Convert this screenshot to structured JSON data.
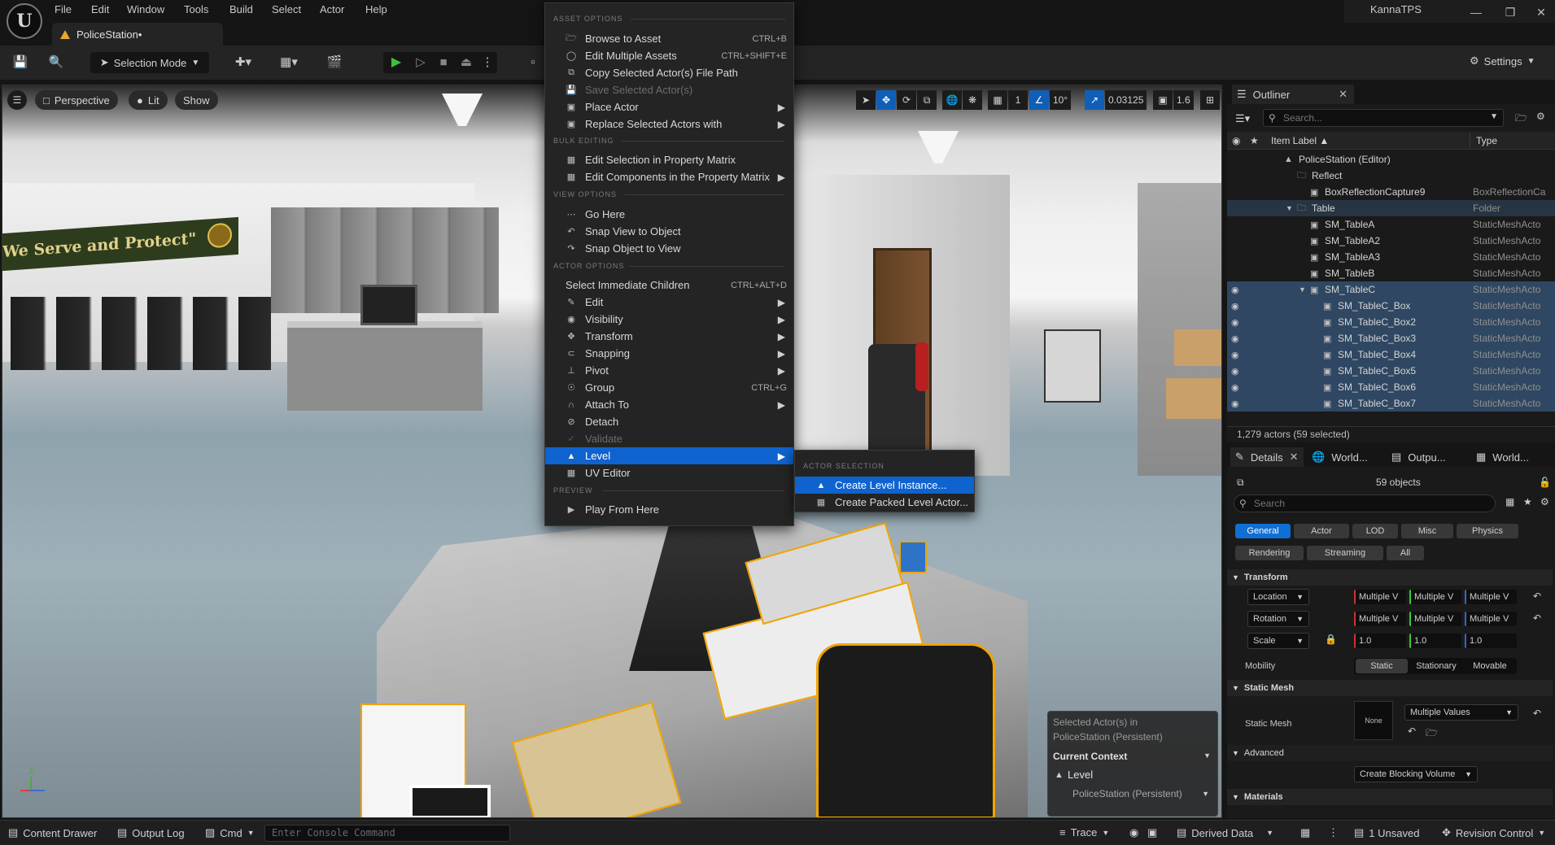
{
  "menubar": {
    "items": [
      "File",
      "Edit",
      "Window",
      "Tools",
      "Build",
      "Select",
      "Actor",
      "Help"
    ],
    "logo": "U",
    "doc_tab": "PoliceStation•",
    "window_title": "KannaTPS"
  },
  "toolbar": {
    "selection_mode": "Selection Mode",
    "settings": "Settings"
  },
  "viewport": {
    "perspective": "Perspective",
    "lit": "Lit",
    "show": "Show",
    "grid_value": "1",
    "angle_value": "10°",
    "scale_value": "0.03125",
    "camera_speed": "1.6",
    "banner_text": "We Serve and Protect\"",
    "context_overlay": {
      "selected_line1": "Selected Actor(s) in",
      "selected_line2": "PoliceStation (Persistent)",
      "current_context": "Current Context",
      "level_label": "Level",
      "level_value": "PoliceStation (Persistent)"
    }
  },
  "context_menu": {
    "sections": {
      "asset_options": "ASSET OPTIONS",
      "bulk_editing": "BULK EDITING",
      "view_options": "VIEW OPTIONS",
      "actor_options": "ACTOR OPTIONS",
      "preview": "PREVIEW"
    },
    "items": {
      "browse": {
        "label": "Browse to Asset",
        "shortcut": "CTRL+B"
      },
      "edit_multiple": {
        "label": "Edit Multiple Assets",
        "shortcut": "CTRL+SHIFT+E"
      },
      "copy_path": {
        "label": "Copy Selected Actor(s) File Path"
      },
      "save_selected": {
        "label": "Save Selected Actor(s)"
      },
      "place_actor": {
        "label": "Place Actor"
      },
      "replace_actors": {
        "label": "Replace Selected Actors with"
      },
      "edit_prop_matrix": {
        "label": "Edit Selection in Property Matrix"
      },
      "edit_comp_matrix": {
        "label": "Edit Components in the Property Matrix"
      },
      "go_here": {
        "label": "Go Here"
      },
      "snap_view": {
        "label": "Snap View to Object"
      },
      "snap_object": {
        "label": "Snap Object to View"
      },
      "select_children": {
        "label": "Select Immediate Children",
        "shortcut": "CTRL+ALT+D"
      },
      "edit": {
        "label": "Edit"
      },
      "visibility": {
        "label": "Visibility"
      },
      "transform": {
        "label": "Transform"
      },
      "snapping": {
        "label": "Snapping"
      },
      "pivot": {
        "label": "Pivot"
      },
      "group": {
        "label": "Group",
        "shortcut": "CTRL+G"
      },
      "attach_to": {
        "label": "Attach To"
      },
      "detach": {
        "label": "Detach"
      },
      "validate": {
        "label": "Validate"
      },
      "level": {
        "label": "Level"
      },
      "uv_editor": {
        "label": "UV Editor"
      },
      "play_from_here": {
        "label": "Play From Here"
      }
    }
  },
  "submenu": {
    "section": "ACTOR SELECTION",
    "create_level_instance": "Create Level Instance...",
    "create_packed": "Create Packed Level Actor..."
  },
  "outliner": {
    "tab": "Outliner",
    "search_placeholder": "Search...",
    "col_item": "Item Label ▲",
    "col_type": "Type",
    "rows": [
      {
        "name": "PoliceStation (Editor)",
        "type": ""
      },
      {
        "name": "Reflect",
        "type": ""
      },
      {
        "name": "BoxReflectionCapture9",
        "type": "BoxReflectionCa"
      },
      {
        "name": "Table",
        "type": "Folder"
      },
      {
        "name": "SM_TableA",
        "type": "StaticMeshActo"
      },
      {
        "name": "SM_TableA2",
        "type": "StaticMeshActo"
      },
      {
        "name": "SM_TableA3",
        "type": "StaticMeshActo"
      },
      {
        "name": "SM_TableB",
        "type": "StaticMeshActo"
      },
      {
        "name": "SM_TableC",
        "type": "StaticMeshActo"
      },
      {
        "name": "SM_TableC_Box",
        "type": "StaticMeshActo"
      },
      {
        "name": "SM_TableC_Box2",
        "type": "StaticMeshActo"
      },
      {
        "name": "SM_TableC_Box3",
        "type": "StaticMeshActo"
      },
      {
        "name": "SM_TableC_Box4",
        "type": "StaticMeshActo"
      },
      {
        "name": "SM_TableC_Box5",
        "type": "StaticMeshActo"
      },
      {
        "name": "SM_TableC_Box6",
        "type": "StaticMeshActo"
      },
      {
        "name": "SM_TableC_Box7",
        "type": "StaticMeshActo"
      }
    ],
    "footer": "1,279 actors (59 selected)"
  },
  "details": {
    "tabs": [
      "Details",
      "World...",
      "Outpu...",
      "World..."
    ],
    "object_count": "59 objects",
    "search_placeholder": "Search",
    "categories": [
      "General",
      "Actor",
      "LOD",
      "Misc",
      "Physics",
      "Rendering",
      "Streaming",
      "All"
    ],
    "transform_section": "Transform",
    "location": "Location",
    "rotation": "Rotation",
    "scale": "Scale",
    "multiple_v": "Multiple V",
    "scale_value": "1.0",
    "mobility": "Mobility",
    "mobility_options": [
      "Static",
      "Stationary",
      "Movable"
    ],
    "static_mesh_section": "Static Mesh",
    "static_mesh_label": "Static Mesh",
    "static_mesh_thumb": "None",
    "static_mesh_value": "Multiple Values",
    "advanced_section": "Advanced",
    "create_blocking": "Create Blocking Volume",
    "materials_section": "Materials"
  },
  "statusbar": {
    "content_drawer": "Content Drawer",
    "output_log": "Output Log",
    "cmd": "Cmd",
    "console_placeholder": "Enter Console Command",
    "trace": "Trace",
    "derived_data": "Derived Data",
    "unsaved": "1 Unsaved",
    "revision_control": "Revision Control"
  },
  "colors": {
    "accent_blue": "#0e63cf",
    "selection_yellow": "#f0a400",
    "warning_orange": "#e8a72a"
  }
}
